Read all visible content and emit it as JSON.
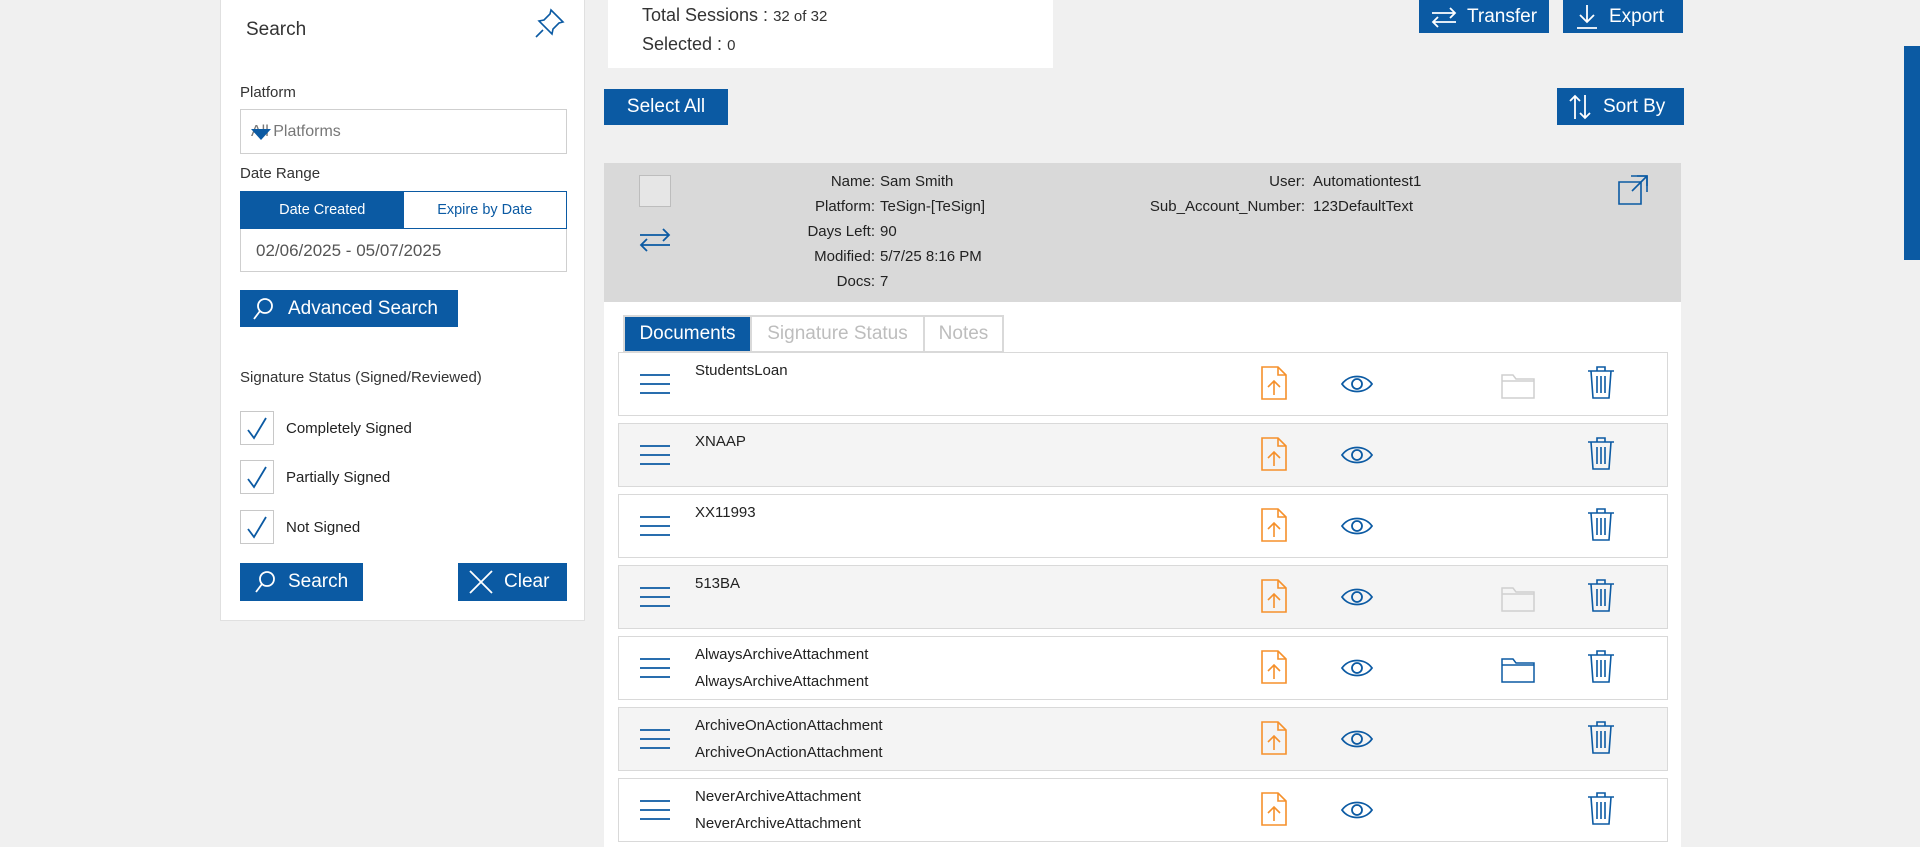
{
  "search_panel": {
    "title": "Search",
    "platform_label": "Platform",
    "platform_value": "All Platforms",
    "date_range_label": "Date Range",
    "date_created_label": "Date Created",
    "expire_by_date_label": "Expire by Date",
    "date_range_value": "02/06/2025 - 05/07/2025",
    "advanced_search_label": "Advanced Search",
    "signature_status_label": "Signature Status (Signed/Reviewed)",
    "checkboxes": [
      {
        "label": "Completely Signed",
        "checked": true
      },
      {
        "label": "Partially Signed",
        "checked": true
      },
      {
        "label": "Not Signed",
        "checked": true
      }
    ],
    "search_button": "Search",
    "clear_button": "Clear"
  },
  "summary": {
    "total_sessions_label": "Total Sessions :",
    "total_sessions_value": "32 of 32",
    "selected_label": "Selected :",
    "selected_value": "0"
  },
  "toolbar": {
    "transfer_label": "Transfer",
    "export_label": "Export",
    "select_all_label": "Select All",
    "sort_by_label": "Sort By"
  },
  "session": {
    "name_label": "Name:",
    "name_value": "Sam Smith",
    "platform_label": "Platform:",
    "platform_value": "TeSign-[TeSign]",
    "days_left_label": "Days Left:",
    "days_left_value": "90",
    "modified_label": "Modified:",
    "modified_value": "5/7/25 8:16 PM",
    "docs_label": "Docs:",
    "docs_value": "7",
    "user_label": "User:",
    "user_value": "Automationtest1",
    "sub_account_label": "Sub_Account_Number:",
    "sub_account_value": "123DefaultText"
  },
  "tabs": [
    "Documents",
    "Signature Status",
    "Notes"
  ],
  "documents": [
    {
      "name": "StudentsLoan",
      "subname": "",
      "folder": "light"
    },
    {
      "name": "XNAAP",
      "subname": "",
      "folder": "none"
    },
    {
      "name": "XX11993",
      "subname": "",
      "folder": "none"
    },
    {
      "name": "513BA",
      "subname": "",
      "folder": "light"
    },
    {
      "name": "AlwaysArchiveAttachment",
      "subname": "AlwaysArchiveAttachment",
      "folder": "blue"
    },
    {
      "name": "ArchiveOnActionAttachment",
      "subname": "ArchiveOnActionAttachment",
      "folder": "none"
    },
    {
      "name": "NeverArchiveAttachment",
      "subname": "NeverArchiveAttachment",
      "folder": "none"
    }
  ],
  "colors": {
    "brand_blue": "#0b5aa3",
    "upload_orange": "#f5902b",
    "header_gray": "#d9d9d9"
  }
}
